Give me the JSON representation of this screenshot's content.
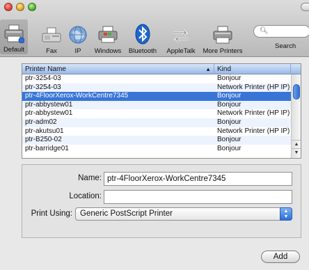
{
  "toolbar": {
    "items": [
      {
        "label": "Default",
        "icon": "printer-icon",
        "selected": true
      },
      {
        "label": "Fax",
        "icon": "fax-icon",
        "selected": false
      },
      {
        "label": "IP",
        "icon": "globe-icon",
        "selected": false
      },
      {
        "label": "Windows",
        "icon": "windows-printer-icon",
        "selected": false
      },
      {
        "label": "Bluetooth",
        "icon": "bluetooth-icon",
        "selected": false
      },
      {
        "label": "AppleTalk",
        "icon": "appletalk-icon",
        "selected": false
      },
      {
        "label": "More Printers",
        "icon": "printer-icon",
        "selected": false
      }
    ],
    "search_label": "Search",
    "search_value": ""
  },
  "printer_list": {
    "columns": {
      "name": "Printer Name",
      "kind": "Kind"
    },
    "rows": [
      {
        "name": "ptr-3254-03",
        "kind": "Bonjour",
        "selected": false
      },
      {
        "name": "ptr-3254-03",
        "kind": "Network Printer (HP IP)",
        "selected": false
      },
      {
        "name": "ptr-4FloorXerox-WorkCentre7345",
        "kind": "Bonjour",
        "selected": true
      },
      {
        "name": "ptr-abbystew01",
        "kind": "Bonjour",
        "selected": false
      },
      {
        "name": "ptr-abbystew01",
        "kind": "Network Printer (HP IP)",
        "selected": false
      },
      {
        "name": "ptr-adm02",
        "kind": "Bonjour",
        "selected": false
      },
      {
        "name": "ptr-akutsu01",
        "kind": "Network Printer (HP IP)",
        "selected": false
      },
      {
        "name": "ptr-B250-02",
        "kind": "Bonjour",
        "selected": false
      },
      {
        "name": "ptr-barridge01",
        "kind": "Bonjour",
        "selected": false
      }
    ]
  },
  "details": {
    "name_label": "Name:",
    "name_value": "ptr-4FloorXerox-WorkCentre7345",
    "location_label": "Location:",
    "location_value": "",
    "print_using_label": "Print Using:",
    "print_using_value": "Generic PostScript Printer"
  },
  "add_button": "Add",
  "colors": {
    "selection": "#3875d7",
    "accent": "#2b6fd6"
  }
}
